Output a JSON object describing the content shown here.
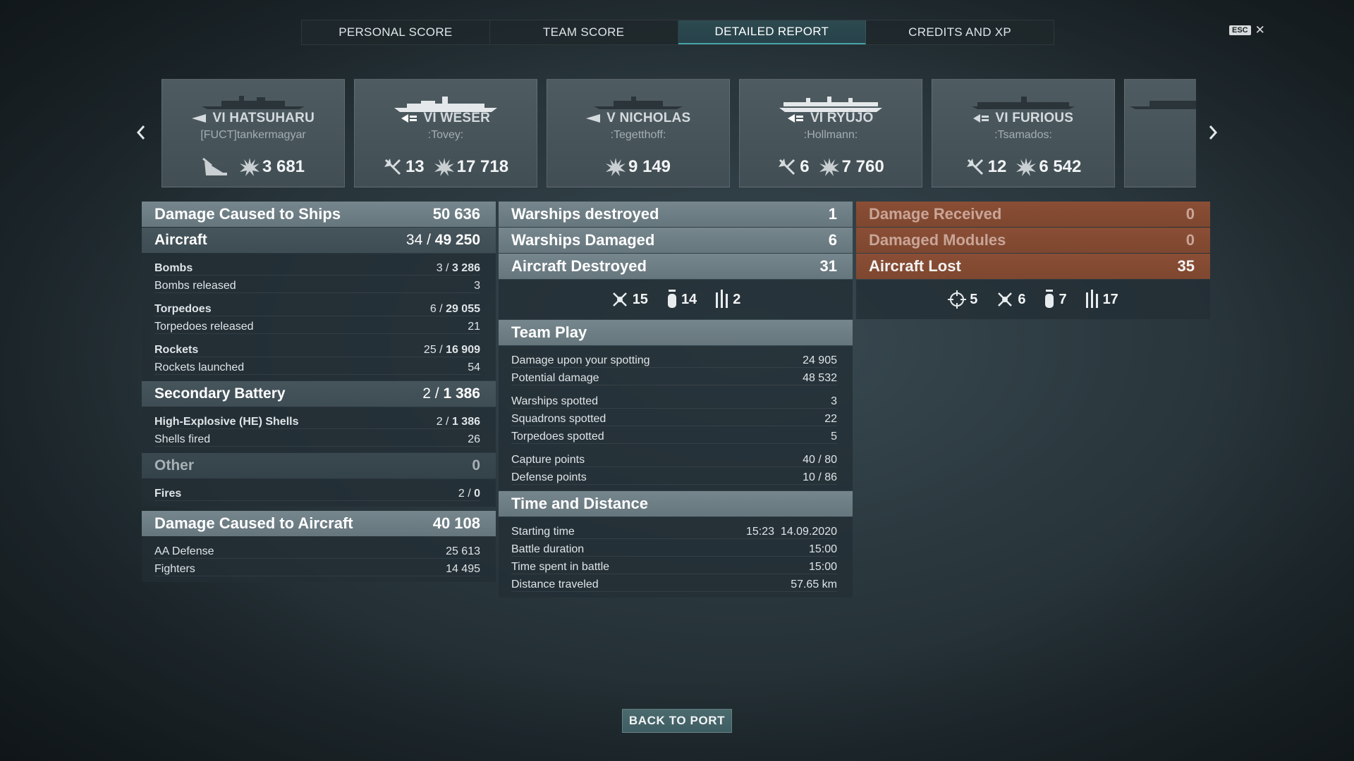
{
  "tabs": [
    {
      "label": "PERSONAL SCORE"
    },
    {
      "label": "TEAM SCORE"
    },
    {
      "label": "DETAILED REPORT"
    },
    {
      "label": "CREDITS AND XP"
    }
  ],
  "esc_label": "ESC",
  "ships": [
    {
      "name": "VI HATSUHARU",
      "player": "[FUCT]tankermagyar",
      "kills": "",
      "damage": "3 681",
      "first_icon": "torpedo-ship-icon"
    },
    {
      "name": "VI WESER",
      "player": ":Tovey:",
      "kills": "13",
      "damage": "17 718",
      "first_icon": "plane-kill-icon"
    },
    {
      "name": "V NICHOLAS",
      "player": ":Tegetthoff:",
      "kills": "",
      "damage": "9 149",
      "first_icon": ""
    },
    {
      "name": "VI RYŪJŌ",
      "player": ":Hollmann:",
      "kills": "6",
      "damage": "7 760",
      "first_icon": "plane-kill-icon"
    },
    {
      "name": "VI FURIOUS",
      "player": ":Tsamados:",
      "kills": "12",
      "damage": "6 542",
      "first_icon": "plane-kill-icon"
    }
  ],
  "left": {
    "damage_ships": {
      "label": "Damage Caused to Ships",
      "value": "50 636"
    },
    "aircraft": {
      "label": "Aircraft",
      "hits": "34",
      "value": "49 250"
    },
    "bombs": {
      "label": "Bombs",
      "hits": "3",
      "value": "3 286"
    },
    "bombs_released": {
      "label": "Bombs released",
      "value": "3"
    },
    "torpedoes": {
      "label": "Torpedoes",
      "hits": "6",
      "value": "29 055"
    },
    "torpedoes_released": {
      "label": "Torpedoes released",
      "value": "21"
    },
    "rockets": {
      "label": "Rockets",
      "hits": "25",
      "value": "16 909"
    },
    "rockets_launched": {
      "label": "Rockets launched",
      "value": "54"
    },
    "secondary": {
      "label": "Secondary Battery",
      "hits": "2",
      "value": "1 386"
    },
    "he_shells": {
      "label": "High-Explosive (HE) Shells",
      "hits": "2",
      "value": "1 386"
    },
    "shells_fired": {
      "label": "Shells fired",
      "value": "26"
    },
    "other": {
      "label": "Other",
      "value": "0"
    },
    "fires": {
      "label": "Fires",
      "hits": "2",
      "value": "0"
    },
    "damage_aircraft": {
      "label": "Damage Caused to Aircraft",
      "value": "40 108"
    },
    "aa_defense": {
      "label": "AA Defense",
      "value": "25 613"
    },
    "fighters": {
      "label": "Fighters",
      "value": "14 495"
    }
  },
  "mid": {
    "warships_destroyed": {
      "label": "Warships destroyed",
      "value": "1"
    },
    "warships_damaged": {
      "label": "Warships Damaged",
      "value": "6"
    },
    "aircraft_destroyed": {
      "label": "Aircraft Destroyed",
      "value": "31"
    },
    "aircraft_icons": [
      {
        "icon": "fighter-icon",
        "value": "15"
      },
      {
        "icon": "bomb-icon",
        "value": "14"
      },
      {
        "icon": "rocket-icon",
        "value": "2"
      }
    ],
    "team_play": {
      "title": "Team Play",
      "rows": [
        {
          "label": "Damage upon your spotting",
          "value": "24 905"
        },
        {
          "label": "Potential damage",
          "value": "48 532"
        },
        {
          "label": "Warships spotted",
          "value": "3"
        },
        {
          "label": "Squadrons spotted",
          "value": "22"
        },
        {
          "label": "Torpedoes spotted",
          "value": "5"
        },
        {
          "label": "Capture points",
          "value": "40 / 80"
        },
        {
          "label": "Defense points",
          "value": "10 / 86"
        }
      ]
    },
    "time_distance": {
      "title": "Time and Distance",
      "rows": [
        {
          "label": "Starting time",
          "value": "15:23  14.09.2020"
        },
        {
          "label": "Battle duration",
          "value": "15:00"
        },
        {
          "label": "Time spent in battle",
          "value": "15:00"
        },
        {
          "label": "Distance traveled",
          "value": "57.65 km"
        }
      ]
    }
  },
  "right": {
    "damage_received": {
      "label": "Damage Received",
      "value": "0"
    },
    "damaged_modules": {
      "label": "Damaged Modules",
      "value": "0"
    },
    "aircraft_lost": {
      "label": "Aircraft Lost",
      "value": "35"
    },
    "lost_icons": [
      {
        "icon": "crosshair-icon",
        "value": "5"
      },
      {
        "icon": "fighter-icon",
        "value": "6"
      },
      {
        "icon": "bomb-icon",
        "value": "7"
      },
      {
        "icon": "rocket-icon",
        "value": "17"
      }
    ]
  },
  "back_button": "BACK TO PORT"
}
